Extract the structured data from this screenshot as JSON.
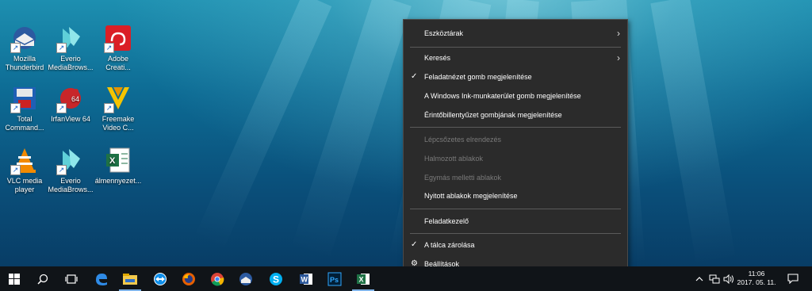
{
  "desktop": {
    "icons": [
      {
        "name": "thunderbird-icon",
        "label": "Mozilla\nThunderbird"
      },
      {
        "name": "everio-icon",
        "label": "Everio\nMediaBrows..."
      },
      {
        "name": "adobe-icon",
        "label": "Adobe\nCreati..."
      },
      {
        "name": "total-commander-icon",
        "label": "Total\nCommand..."
      },
      {
        "name": "irfanview-icon",
        "label": "IrfanView 64"
      },
      {
        "name": "freemake-icon",
        "label": "Freemake\nVideo C..."
      },
      {
        "name": "vlc-icon",
        "label": "VLC media\nplayer"
      },
      {
        "name": "everio-icon-2",
        "label": "Everio\nMediaBrows..."
      },
      {
        "name": "excel-file-icon",
        "label": "álmennyezet..."
      }
    ]
  },
  "context_menu": {
    "items": [
      {
        "label": "Eszköztárak",
        "submenu": true,
        "checked": false,
        "disabled": false
      },
      {
        "label": "Keresés",
        "submenu": true,
        "checked": false,
        "disabled": false
      },
      {
        "label": "Feladatnézet gomb megjelenítése",
        "submenu": false,
        "checked": true,
        "disabled": false
      },
      {
        "label": "A Windows Ink-munkaterület gomb megjelenítése",
        "submenu": false,
        "checked": false,
        "disabled": false
      },
      {
        "label": "Érintőbillentyűzet gombjának megjelenítése",
        "submenu": false,
        "checked": false,
        "disabled": false
      },
      {
        "label": "Lépcsőzetes elrendezés",
        "submenu": false,
        "checked": false,
        "disabled": true
      },
      {
        "label": "Halmozott ablakok",
        "submenu": false,
        "checked": false,
        "disabled": true
      },
      {
        "label": "Egymás melletti ablakok",
        "submenu": false,
        "checked": false,
        "disabled": true
      },
      {
        "label": "Nyitott ablakok megjelenítése",
        "submenu": false,
        "checked": false,
        "disabled": false
      },
      {
        "label": "Feladatkezelő",
        "submenu": false,
        "checked": false,
        "disabled": false
      },
      {
        "label": "A tálca zárolása",
        "submenu": false,
        "checked": true,
        "disabled": false
      },
      {
        "label": "Beállítások",
        "submenu": false,
        "checked": false,
        "disabled": false,
        "icon": "gear-icon"
      }
    ]
  },
  "taskbar": {
    "pinned": [
      "start-button",
      "search-button",
      "task-view-button",
      "edge-icon",
      "file-explorer-icon",
      "teamviewer-icon",
      "firefox-icon",
      "chrome-icon",
      "thunderbird-icon",
      "skype-icon",
      "word-icon",
      "photoshop-icon",
      "excel-icon"
    ],
    "clock_time": "11:06",
    "clock_date": "2017. 05. 11.",
    "glyphs": {
      "chevron_up": "^",
      "submenu_arrow": "›",
      "check": "✓",
      "gear": "⚙",
      "speaker": "🔊",
      "notification": "🗨"
    }
  }
}
